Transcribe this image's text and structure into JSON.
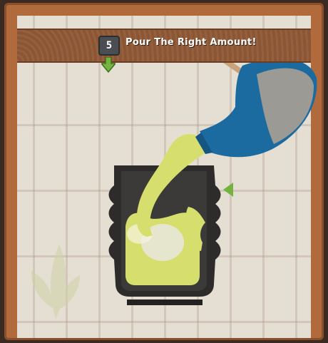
{
  "game": {
    "pour_count": "5",
    "instruction": "Pour The Right Amount!"
  },
  "colors": {
    "frame": "#b06a3c",
    "banner": "#8c5634",
    "paper": "#e5ded2",
    "tea": "#d6df6e",
    "kettle": "#1b6aa0",
    "cup": "#2e2c2a",
    "marker": "#74b33f"
  },
  "icons": [
    "down-arrow-icon",
    "side-arrow-icon",
    "tea-leaf-icon"
  ]
}
